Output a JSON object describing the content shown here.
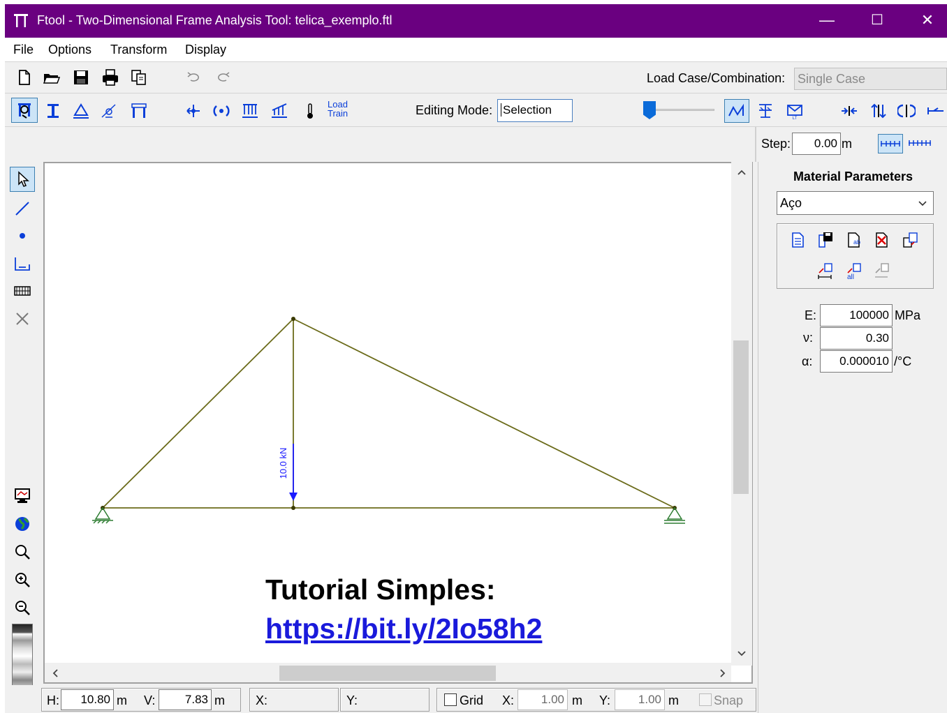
{
  "window": {
    "title": "Ftool - Two-Dimensional Frame Analysis Tool: telica_exemplo.ftl",
    "controls": {
      "minimize": "—",
      "maximize": "☐",
      "close": "✕"
    }
  },
  "menu": [
    "File",
    "Options",
    "Transform",
    "Display"
  ],
  "toolbar1": {
    "load_case_label": "Load Case/Combination:",
    "load_case_value": "Single Case"
  },
  "toolbar2": {
    "editing_mode_label": "Editing Mode:",
    "editing_mode_value": "Selection",
    "load_train_label_1": "Load",
    "load_train_label_2": "Train"
  },
  "step_bar": {
    "step_label": "Step:",
    "step_value": "0.00",
    "step_unit": "m"
  },
  "model": {
    "load_label": "10.0 kN"
  },
  "overlay": {
    "heading": "Tutorial Simples:",
    "link": "https://bit.ly/2Io58h2"
  },
  "material": {
    "title": "Material Parameters",
    "selected": "Aço",
    "e_label": "E:",
    "e_value": "100000",
    "e_unit": "MPa",
    "nu_label": "ν:",
    "nu_value": "0.30",
    "alpha_label": "α:",
    "alpha_value": "0.000010",
    "alpha_unit": "/°C"
  },
  "status": {
    "h_label": "H:",
    "h_value": "10.80",
    "h_unit": "m",
    "v_label": "V:",
    "v_value": "7.83",
    "v_unit": "m",
    "x_label": "X:",
    "y_label": "Y:",
    "grid_label": "Grid",
    "gx_label": "X:",
    "gx_value": "1.00",
    "gx_unit": "m",
    "gy_label": "Y:",
    "gy_value": "1.00",
    "gy_unit": "m",
    "snap_label": "Snap"
  },
  "colors": {
    "titlebar": "#6a0080",
    "member": "#6b6b1a",
    "load": "#1a1aff",
    "support": "#2e7d32",
    "link": "#1a1adb"
  }
}
